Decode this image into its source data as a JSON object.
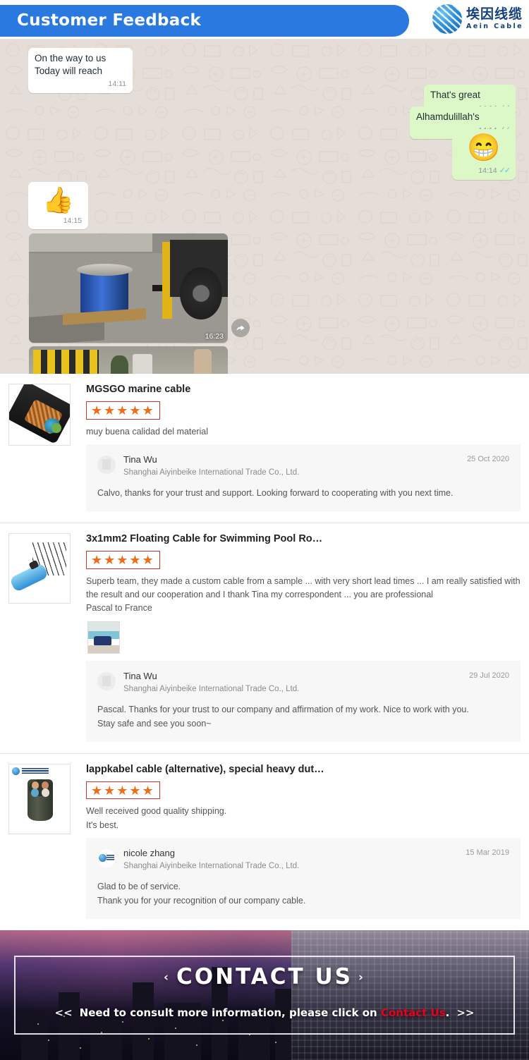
{
  "header": {
    "title": "Customer Feedback",
    "brand_cn": "埃因线缆",
    "brand_en": "Aein Cable"
  },
  "chat": {
    "messages": [
      {
        "id": "m1",
        "side": "in",
        "text": "On the way to us\nToday will reach",
        "time": "14:11",
        "ticks": ""
      },
      {
        "id": "m2",
        "side": "out",
        "text": "That's great",
        "time": "14:14",
        "ticks": "✓✓"
      },
      {
        "id": "m3",
        "side": "out",
        "text": "Alhamdulillah's",
        "time": "14:14",
        "ticks": "✓✓"
      },
      {
        "id": "m4",
        "side": "out",
        "emoji": "😁",
        "time": "14:14",
        "ticks": "✓✓"
      },
      {
        "id": "m5",
        "side": "in",
        "emoji": "👍",
        "time": "14:15",
        "ticks": ""
      }
    ],
    "photos": [
      {
        "id": "p1",
        "caption": "cable drum on pallet with forklift",
        "time": "16:23"
      },
      {
        "id": "p2",
        "caption": "street with yellow barrier",
        "time": ""
      }
    ],
    "forward_icon": "forward-arrow-icon"
  },
  "reviews": [
    {
      "product_title": "MGSGO marine cable",
      "thumb_name": "marine-cable-thumbnail",
      "stars": "★★★★★",
      "rating": 5,
      "review_text": "muy buena calidad del material",
      "reply": {
        "name": "Tina Wu",
        "company": "Shanghai Aiyinbeike International Trade Co., Ltd.",
        "date": "25 Oct 2020",
        "text": "Calvo, thanks for your trust and support. Looking forward to cooperating with you next time."
      }
    },
    {
      "product_title": "3x1mm2 Floating Cable for Swimming Pool Ro…",
      "thumb_name": "floating-cable-thumbnail",
      "stars": "★★★★★",
      "rating": 5,
      "review_text": "Superb team, they made a custom cable from a sample ... with very short lead times ... I am really satisfied with the result and our cooperation and I thank Tina my correspondent ... you are professional\nPascal to France",
      "review_photo": "pool-robot-photo",
      "reply": {
        "name": "Tina Wu",
        "company": "Shanghai Aiyinbeike International Trade Co., Ltd.",
        "date": "29 Jul 2020",
        "text": "Pascal. Thanks for your trust to our company and affirmation of my work. Nice to work with you.\nStay safe and see you soon~"
      }
    },
    {
      "product_title": "lappkabel cable (alternative), special heavy dut…",
      "thumb_name": "heavy-duty-cable-thumbnail",
      "stars": "★★★★★",
      "rating": 5,
      "review_text": "Well received good quality shipping.\nIt's best.",
      "reply": {
        "name": "nicole zhang",
        "company": "Shanghai Aiyinbeike International Trade Co., Ltd.",
        "date": "15 Mar 2019",
        "text": "Glad to be of service.\nThank you for your recognition of our company cable."
      }
    }
  ],
  "contact": {
    "title": "CONTACT US",
    "caret_left": "‹",
    "caret_right": "›",
    "arrows_left": "<<",
    "arrows_right": ">>",
    "subtitle_before": "Need to consult more information, please click on ",
    "subtitle_link": "Contact Us",
    "subtitle_after": "."
  },
  "colors": {
    "header_blue": "#2979e0",
    "star_orange": "#ef6c19",
    "star_border_red": "#c0392b",
    "link_red": "#e8001c",
    "chat_bg": "#e5ded8",
    "bubble_out": "#dcf8c6"
  }
}
